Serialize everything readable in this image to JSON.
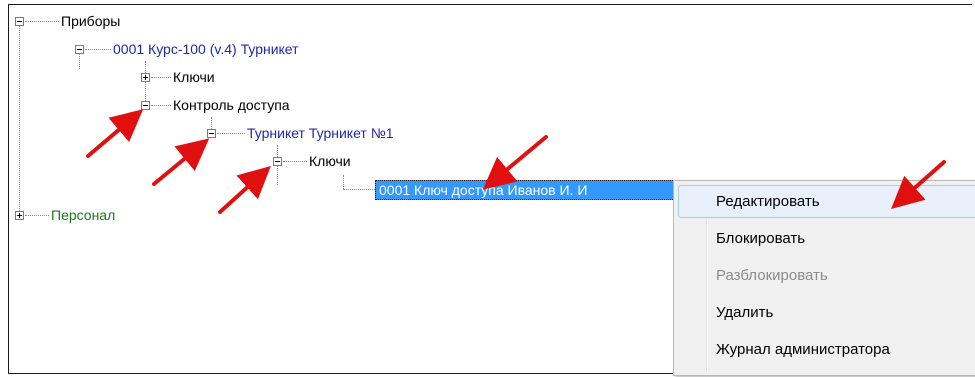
{
  "tree": {
    "root_devices": "Приборы",
    "device": "0001  Курс-100 (v.4)  Турникет",
    "keys": "Ключи",
    "access_control": "Контроль доступа",
    "turnstile": "Турникет  Турникет №1",
    "turnstile_keys": "Ключи",
    "selected_key": "0001  Ключ доступа  Иванов И. И",
    "personnel": "Персонал"
  },
  "context_menu": {
    "items": [
      {
        "label": "Редактировать",
        "state": "highlighted"
      },
      {
        "label": "Блокировать",
        "state": "enabled"
      },
      {
        "label": "Разблокировать",
        "state": "disabled"
      },
      {
        "label": "Удалить",
        "state": "enabled"
      },
      {
        "label": "Журнал администратора",
        "state": "enabled"
      }
    ]
  },
  "colors": {
    "device_text": "#1e2aa8",
    "personnel_text": "#1a7a1a",
    "selection_bg": "#3399ff",
    "annotation_arrow": "#e01010"
  }
}
